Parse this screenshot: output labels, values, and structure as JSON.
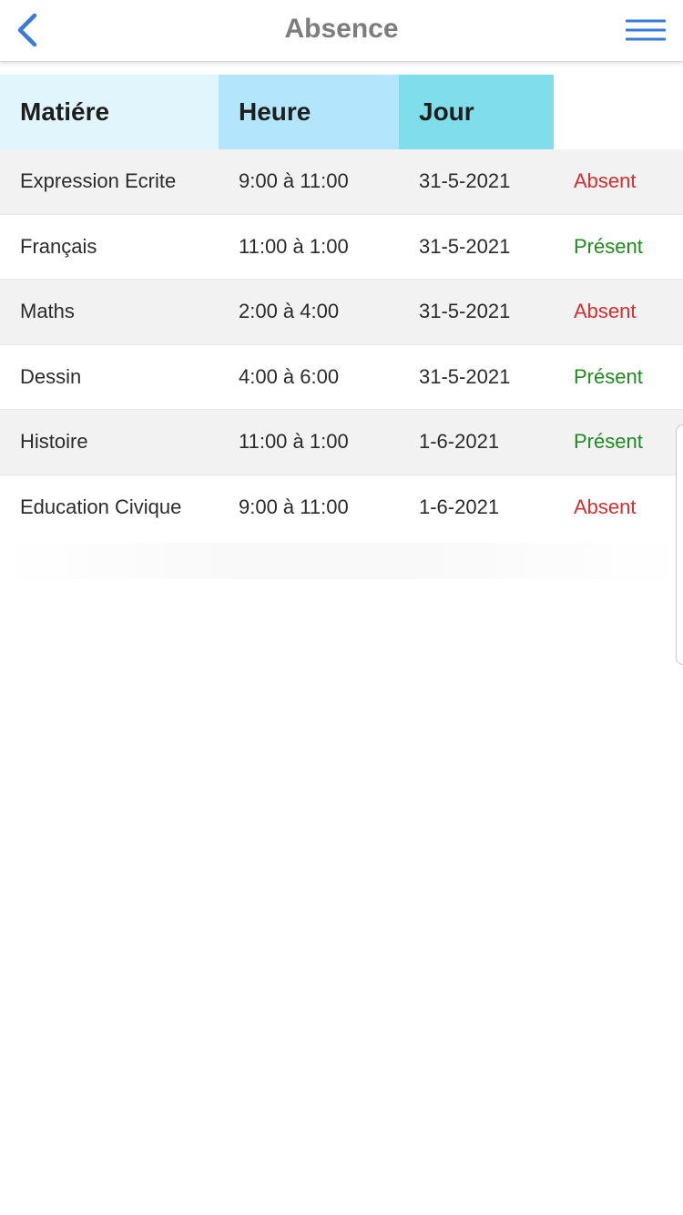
{
  "header": {
    "title": "Absence",
    "back_icon": "chevron-left-icon",
    "menu_icon": "hamburger-menu-icon",
    "accent_color": "#3a7bd5"
  },
  "table": {
    "columns": [
      "Matiére",
      "Heure",
      "Jour",
      ""
    ],
    "rows": [
      {
        "subject": "Expression Ecrite",
        "time": "9:00 à 11:00",
        "day": "31-5-2021",
        "status": "Absent"
      },
      {
        "subject": "Français",
        "time": "11:00 à 1:00",
        "day": "31-5-2021",
        "status": "Présent"
      },
      {
        "subject": "Maths",
        "time": "2:00 à 4:00",
        "day": "31-5-2021",
        "status": "Absent"
      },
      {
        "subject": "Dessin",
        "time": "4:00 à 6:00",
        "day": "31-5-2021",
        "status": "Présent"
      },
      {
        "subject": "Histoire",
        "time": "11:00 à 1:00",
        "day": "1-6-2021",
        "status": "Présent"
      },
      {
        "subject": "Education Civique",
        "time": "9:00 à 11:00",
        "day": "1-6-2021",
        "status": "Absent"
      }
    ]
  },
  "colors": {
    "absent": "#d32f2f",
    "present": "#1f8a1f",
    "header_col1": "#e1f5fd",
    "header_col2": "#b3e5fc",
    "header_col3": "#80deea"
  }
}
